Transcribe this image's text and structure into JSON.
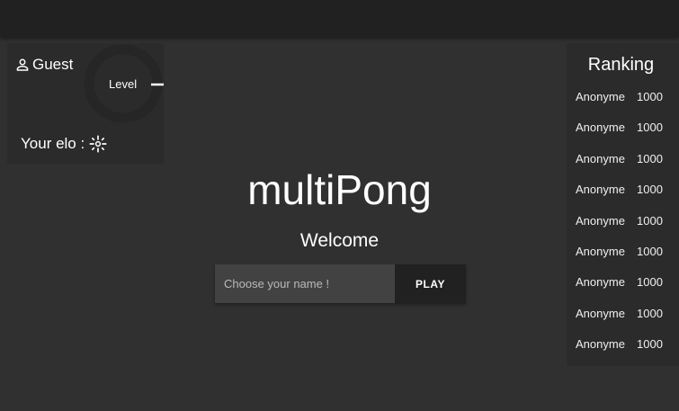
{
  "header": {},
  "profile": {
    "username": "Guest",
    "level_label": "Level",
    "elo_label": "Your elo :",
    "icons": {
      "user": "person-outline-icon",
      "elo": "loading-sun-icon"
    }
  },
  "main": {
    "title": "multiPong",
    "welcome": "Welcome",
    "name_placeholder": "Choose your name !",
    "name_value": "",
    "play_label": "PLAY"
  },
  "ranking": {
    "title": "Ranking",
    "entries": [
      {
        "name": "Anonyme",
        "elo": "1000"
      },
      {
        "name": "Anonyme",
        "elo": "1000"
      },
      {
        "name": "Anonyme",
        "elo": "1000"
      },
      {
        "name": "Anonyme",
        "elo": "1000"
      },
      {
        "name": "Anonyme",
        "elo": "1000"
      },
      {
        "name": "Anonyme",
        "elo": "1000"
      },
      {
        "name": "Anonyme",
        "elo": "1000"
      },
      {
        "name": "Anonyme",
        "elo": "1000"
      },
      {
        "name": "Anonyme",
        "elo": "1000"
      }
    ]
  },
  "colors": {
    "background": "#303030",
    "toolbar": "#212121",
    "card": "#2b2b2b",
    "input": "#424242",
    "text": "#ffffff"
  }
}
